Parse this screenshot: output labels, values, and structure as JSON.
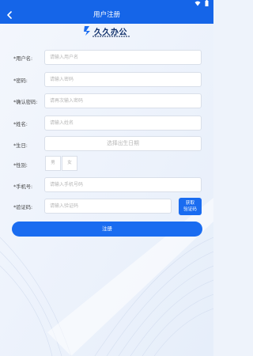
{
  "header": {
    "title": "用户注册"
  },
  "logo": {
    "text": "久久办公"
  },
  "form": {
    "username": {
      "label": "*用户名:",
      "placeholder": "请输入用户名"
    },
    "password": {
      "label": "*密码:",
      "placeholder": "请输入密码"
    },
    "confirm_password": {
      "label": "*确认密码:",
      "placeholder": "请再次输入密码"
    },
    "name": {
      "label": "*姓名:",
      "placeholder": "请输入姓名"
    },
    "birthday": {
      "label": "*生日:",
      "placeholder": "选择出生日期"
    },
    "gender": {
      "label": "*性别:",
      "options": [
        "男",
        "女"
      ]
    },
    "phone": {
      "label": "*手机号:",
      "placeholder": "请输入手机号码"
    },
    "code": {
      "label": "*验证码:",
      "placeholder": "请输入验证码",
      "button_line1": "获取",
      "button_line2": "验证码"
    },
    "submit_label": "注册"
  },
  "colors": {
    "primary": "#1565e8",
    "button": "#1a6cf0",
    "background": "#eef3fb"
  },
  "icons": [
    "wifi-icon",
    "battery-icon",
    "back-arrow-icon"
  ]
}
